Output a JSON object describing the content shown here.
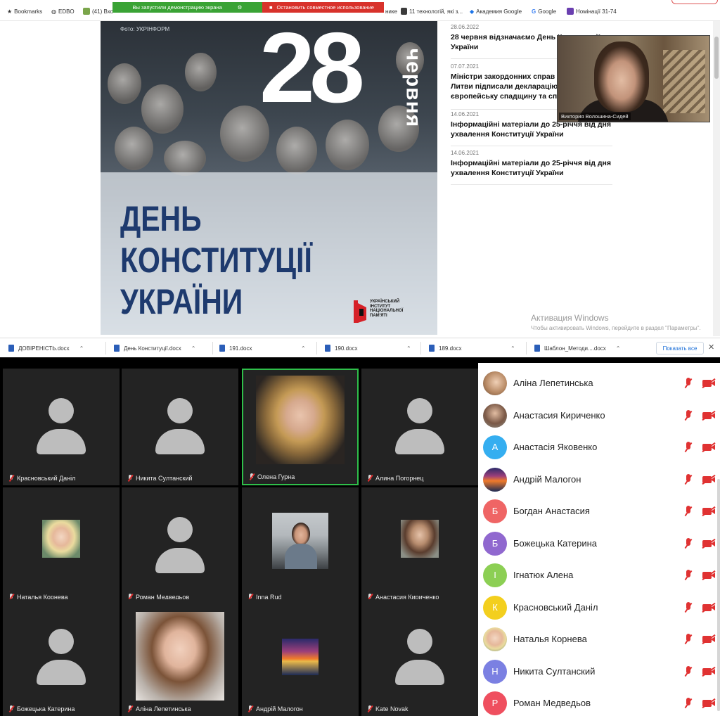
{
  "bookmarks_bar": {
    "items": [
      {
        "label": "Bookmarks",
        "icon": "star-icon"
      },
      {
        "label": "EDBO",
        "icon": "globe-icon"
      },
      {
        "label": "(41) Вхо",
        "icon": "mail-icon"
      },
      {
        "label": "нике",
        "icon": "page-icon"
      },
      {
        "label": "11 технологій, які з...",
        "icon": "excel-icon"
      },
      {
        "label": "Академия Google",
        "icon": "google-academy-icon"
      },
      {
        "label": "Google",
        "icon": "google-icon"
      },
      {
        "label": "Номінації 31-74",
        "icon": "forms-icon"
      }
    ]
  },
  "screen_share_bar": {
    "message": "Вы запустили демонстрацию экрана",
    "stop_label": "Остановить совместное использование"
  },
  "poster": {
    "photo_credit": "Фото: УКРІНФОРМ",
    "day": "28",
    "month": "червня",
    "title_lines": [
      "ДЕНЬ",
      "КОНСТИТУЦІЇ",
      "УКРАЇНИ"
    ],
    "logo_text_lines": [
      "УКРАЇНСЬКИЙ",
      "ІНСТИТУТ",
      "НАЦІОНАЛЬНОЇ",
      "ПАМ'ЯТІ"
    ]
  },
  "news": [
    {
      "date": "28.06.2022",
      "title": "28 червня відзначаємо День Конституції України"
    },
    {
      "date": "07.07.2021",
      "title": "Міністри закордонних справ України та Литви підписали декларацію про європейську спадщину та співпрацю"
    },
    {
      "date": "14.06.2021",
      "title": "Інформаційні матеріали до 25-річчя від дня ухвалення Конституції України"
    },
    {
      "date": "14.06.2021",
      "title": "Інформаційні матеріали до 25-річчя від дня ухвалення Конституції України"
    }
  ],
  "presenter": {
    "name": "Виктория Волошина-Сидей"
  },
  "windows_activation": {
    "title": "Активация Windows",
    "text": "Чтобы активировать Windows, перейдите в раздел \"Параметры\"."
  },
  "downloads": {
    "files": [
      "ДОВІРЕНІСТЬ.docx",
      "День Конституції.docx",
      "191.docx",
      "190.docx",
      "189.docx",
      "Шаблон_Методи....docx"
    ],
    "show_all_label": "Показать все",
    "close_symbol": "✕"
  },
  "video_tiles": [
    {
      "name": "Красновський Даніл",
      "photo": null
    },
    {
      "name": "Никита Султанский",
      "photo": null
    },
    {
      "name": "Олена Гурна",
      "photo": "portrait-blonde",
      "active": true
    },
    {
      "name": "Алина Погорнец",
      "photo": null
    },
    {
      "name": "Наталья Корнева",
      "photo": "small-blonde"
    },
    {
      "name": "Роман Медведьов",
      "photo": null
    },
    {
      "name": "Inna Rud",
      "photo": "office-woman"
    },
    {
      "name": "Анастасия Кириченко",
      "photo": "small-brunette"
    },
    {
      "name": "Божецька Катерина",
      "photo": null
    },
    {
      "name": "Аліна Лепетинська",
      "photo": "large-girl"
    },
    {
      "name": "Андрій Малогон",
      "photo": "sunset"
    },
    {
      "name": "Kate Novak",
      "photo": null
    }
  ],
  "participants": [
    {
      "name": "Аліна Лепетинська",
      "initial": "",
      "color": "#c9a27e",
      "photo": true
    },
    {
      "name": "Анастасия Кириченко",
      "initial": "",
      "color": "#6d4b3a",
      "photo": true
    },
    {
      "name": "Анастасія Яковенко",
      "initial": "А",
      "color": "#35aef0"
    },
    {
      "name": "Андрій Малогон",
      "initial": "",
      "color": "#d9532b",
      "photo": true
    },
    {
      "name": "Богдан Анастасия",
      "initial": "Б",
      "color": "#ef6565"
    },
    {
      "name": "Божецька Катерина",
      "initial": "Б",
      "color": "#9068cf"
    },
    {
      "name": "Ігнатюк Алена",
      "initial": "І",
      "color": "#8ccf54"
    },
    {
      "name": "Красновський Даніл",
      "initial": "К",
      "color": "#f3cf1e"
    },
    {
      "name": "Наталья Корнева",
      "initial": "",
      "color": "#d9c08a",
      "photo": true
    },
    {
      "name": "Никита Султанский",
      "initial": "Н",
      "color": "#7b80e2"
    },
    {
      "name": "Роман Медведьов",
      "initial": "Р",
      "color": "#ef4f5f"
    }
  ]
}
